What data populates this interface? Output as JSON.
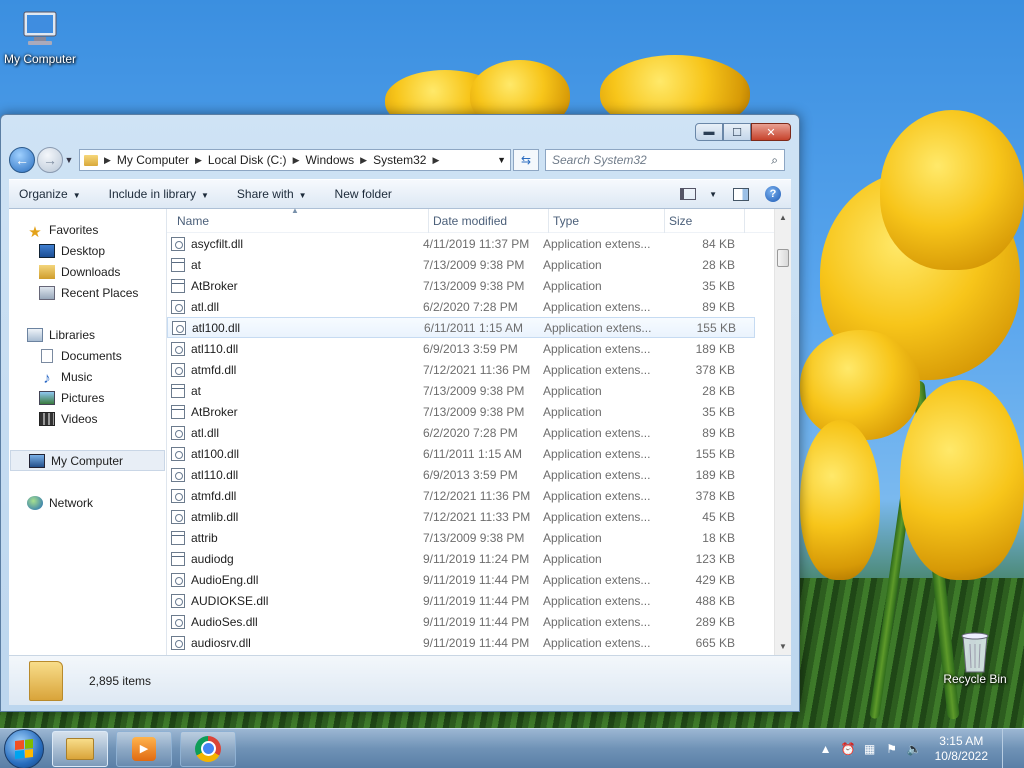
{
  "desktop": {
    "icons": [
      {
        "label": "My Computer",
        "icon": "computer-icon"
      },
      {
        "label": "Recycle Bin",
        "icon": "recycle-bin-icon"
      }
    ]
  },
  "window": {
    "buttons": {
      "minimize": "▬",
      "maximize": "☐",
      "close": "✕"
    },
    "address": {
      "segments": [
        "My Computer",
        "Local Disk (C:)",
        "Windows",
        "System32"
      ]
    },
    "search": {
      "placeholder": "Search System32"
    },
    "toolbar": {
      "organize": "Organize",
      "include_in_library": "Include in library",
      "share_with": "Share with",
      "new_folder": "New folder"
    },
    "nav": {
      "favorites": "Favorites",
      "desktop": "Desktop",
      "downloads": "Downloads",
      "recent_places": "Recent Places",
      "libraries": "Libraries",
      "documents": "Documents",
      "music": "Music",
      "pictures": "Pictures",
      "videos": "Videos",
      "my_computer": "My Computer",
      "network": "Network"
    },
    "columns": {
      "name": "Name",
      "date": "Date modified",
      "type": "Type",
      "size": "Size"
    },
    "files": [
      {
        "name": "asycfilt.dll",
        "date": "4/11/2019 11:37 PM",
        "type": "Application extens...",
        "size": "84 KB",
        "kind": "dll"
      },
      {
        "name": "at",
        "date": "7/13/2009 9:38 PM",
        "type": "Application",
        "size": "28 KB",
        "kind": "app"
      },
      {
        "name": "AtBroker",
        "date": "7/13/2009 9:38 PM",
        "type": "Application",
        "size": "35 KB",
        "kind": "app"
      },
      {
        "name": "atl.dll",
        "date": "6/2/2020 7:28 PM",
        "type": "Application extens...",
        "size": "89 KB",
        "kind": "dll"
      },
      {
        "name": "atl100.dll",
        "date": "6/11/2011 1:15 AM",
        "type": "Application extens...",
        "size": "155 KB",
        "kind": "dll"
      },
      {
        "name": "atl110.dll",
        "date": "6/9/2013 3:59 PM",
        "type": "Application extens...",
        "size": "189 KB",
        "kind": "dll"
      },
      {
        "name": "atmfd.dll",
        "date": "7/12/2021 11:36 PM",
        "type": "Application extens...",
        "size": "378 KB",
        "kind": "dll"
      },
      {
        "name": "at",
        "date": "7/13/2009 9:38 PM",
        "type": "Application",
        "size": "28 KB",
        "kind": "app"
      },
      {
        "name": "AtBroker",
        "date": "7/13/2009 9:38 PM",
        "type": "Application",
        "size": "35 KB",
        "kind": "app"
      },
      {
        "name": "atl.dll",
        "date": "6/2/2020 7:28 PM",
        "type": "Application extens...",
        "size": "89 KB",
        "kind": "dll"
      },
      {
        "name": "atl100.dll",
        "date": "6/11/2011 1:15 AM",
        "type": "Application extens...",
        "size": "155 KB",
        "kind": "dll"
      },
      {
        "name": "atl110.dll",
        "date": "6/9/2013 3:59 PM",
        "type": "Application extens...",
        "size": "189 KB",
        "kind": "dll"
      },
      {
        "name": "atmfd.dll",
        "date": "7/12/2021 11:36 PM",
        "type": "Application extens...",
        "size": "378 KB",
        "kind": "dll"
      },
      {
        "name": "atmlib.dll",
        "date": "7/12/2021 11:33 PM",
        "type": "Application extens...",
        "size": "45 KB",
        "kind": "dll"
      },
      {
        "name": "attrib",
        "date": "7/13/2009 9:38 PM",
        "type": "Application",
        "size": "18 KB",
        "kind": "app"
      },
      {
        "name": "audiodg",
        "date": "9/11/2019 11:24 PM",
        "type": "Application",
        "size": "123 KB",
        "kind": "app"
      },
      {
        "name": "AudioEng.dll",
        "date": "9/11/2019 11:44 PM",
        "type": "Application extens...",
        "size": "429 KB",
        "kind": "dll"
      },
      {
        "name": "AUDIOKSE.dll",
        "date": "9/11/2019 11:44 PM",
        "type": "Application extens...",
        "size": "488 KB",
        "kind": "dll"
      },
      {
        "name": "AudioSes.dll",
        "date": "9/11/2019 11:44 PM",
        "type": "Application extens...",
        "size": "289 KB",
        "kind": "dll"
      },
      {
        "name": "audiosrv.dll",
        "date": "9/11/2019 11:44 PM",
        "type": "Application extens...",
        "size": "665 KB",
        "kind": "dll"
      }
    ],
    "hovered_row": 4,
    "status": {
      "item_count": "2,895 items"
    }
  },
  "taskbar": {
    "clock": {
      "time": "3:15 AM",
      "date": "10/8/2022"
    }
  }
}
